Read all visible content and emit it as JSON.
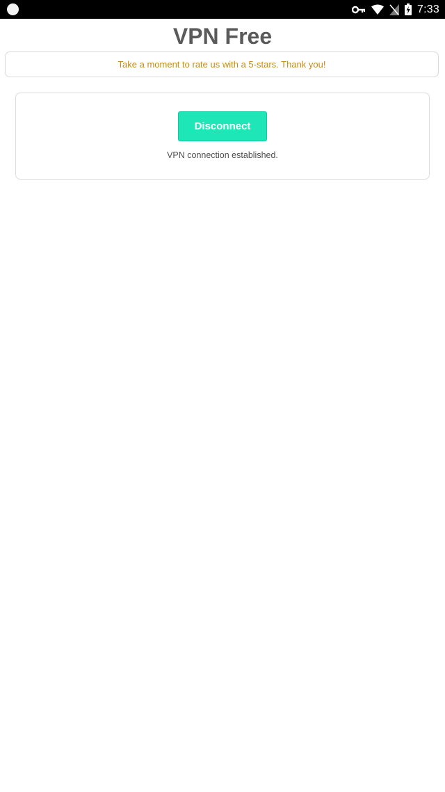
{
  "status_bar": {
    "time": "7:33",
    "icons": [
      "notification-dot-icon",
      "vpn-key-icon",
      "wifi-icon",
      "no-sim-icon",
      "battery-charging-icon"
    ]
  },
  "app": {
    "title": "VPN Free"
  },
  "banner": {
    "message": "Take a moment to rate us with a 5-stars. Thank you!",
    "color": "#c78a14"
  },
  "vpn": {
    "button_label": "Disconnect",
    "button_color": "#1ee6b6",
    "status": "VPN connection established."
  }
}
